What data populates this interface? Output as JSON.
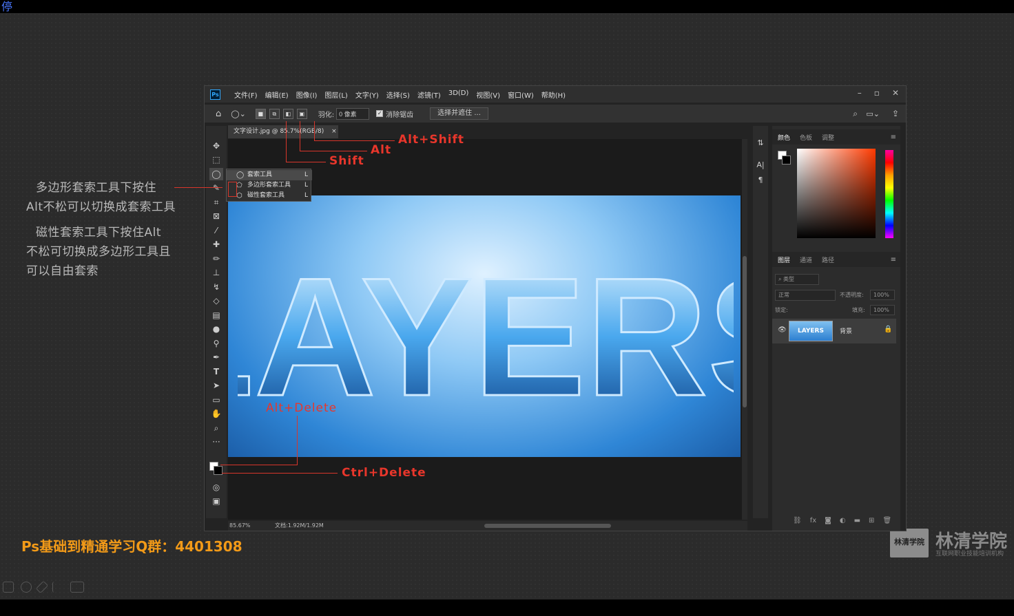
{
  "overlay": {
    "pause_label": "停",
    "annotation_polygon": [
      "多边形套索工具下按住",
      "Alt不松可以切换成套索工具"
    ],
    "annotation_magnetic": [
      "磁性套索工具下按住Alt",
      "不松可切换成多边形工具且",
      "可以自由套索"
    ],
    "shortcuts": {
      "shift": "Shift",
      "alt": "Alt",
      "alt_shift": "Alt+Shift",
      "alt_delete": "Alt+Delete",
      "ctrl_delete": "Ctrl+Delete"
    },
    "qq_group": "Ps基础到精通学习Q群：4401308",
    "watermark": {
      "seal": "林清学院",
      "name": "林清学院",
      "sub": "互联网职业技能培训机构"
    },
    "accent_red": "#e8362b",
    "accent_orange": "#f29a18"
  },
  "ps": {
    "logo": "Ps",
    "menus": [
      "文件(F)",
      "编辑(E)",
      "图像(I)",
      "图层(L)",
      "文字(Y)",
      "选择(S)",
      "滤镜(T)",
      "3D(D)",
      "视图(V)",
      "窗口(W)",
      "帮助(H)"
    ],
    "window_controls": {
      "minimize": "–",
      "maximize": "▫",
      "close": "✕"
    },
    "options": {
      "feather_label": "羽化:",
      "feather_value": "0 像素",
      "antialias_label": "消除锯齿",
      "antialias_checked": "✓",
      "select_mask": "选择并遮住 ..."
    },
    "doc_tab": "文字设计.jpg @ 85.7%(RGB/8)",
    "doc_tab_close": "×",
    "artwork_text": "LAYERS",
    "status": {
      "zoom": "85.67%",
      "doc_size": "文档:1.92M/1.92M"
    },
    "lasso_flyout": [
      {
        "label": "套索工具",
        "key": "L",
        "icon": "lasso-icon"
      },
      {
        "label": "多边形套索工具",
        "key": "L",
        "icon": "polygonal-lasso-icon"
      },
      {
        "label": "磁性套索工具",
        "key": "L",
        "icon": "magnetic-lasso-icon"
      }
    ],
    "color_panel_tabs": [
      "颜色",
      "色板",
      "调整"
    ],
    "layers_panel_tabs": [
      "图层",
      "通道",
      "路径"
    ],
    "layers": {
      "filter": "类型",
      "blend_mode": "正常",
      "opacity_label": "不透明度:",
      "opacity_value": "100%",
      "lock_label": "锁定:",
      "fill_label": "填充:",
      "fill_value": "100%",
      "layer_name": "背景",
      "layer_thumb_text": "LAYERS"
    }
  }
}
